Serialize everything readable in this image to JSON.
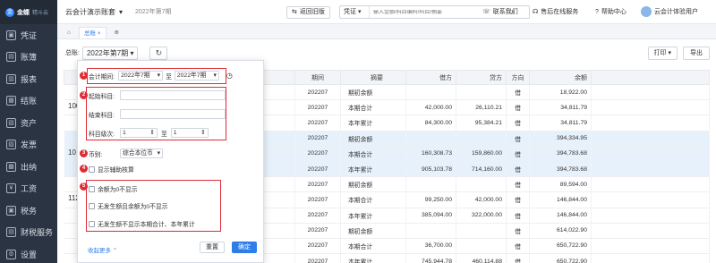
{
  "app": {
    "logo_mark": "金",
    "logo_text": "金蝶",
    "logo_sub": "精斗云"
  },
  "sidebar": {
    "items": [
      {
        "label": "凭证",
        "icon": "voucher-icon",
        "glyph": "▣"
      },
      {
        "label": "账簿",
        "icon": "ledger-icon",
        "glyph": "▤"
      },
      {
        "label": "报表",
        "icon": "report-icon",
        "glyph": "▥"
      },
      {
        "label": "结账",
        "icon": "closing-icon",
        "glyph": "▦"
      },
      {
        "label": "资产",
        "icon": "asset-icon",
        "glyph": "▧"
      },
      {
        "label": "发票",
        "icon": "invoice-icon",
        "glyph": "▨"
      },
      {
        "label": "出纳",
        "icon": "cashier-icon",
        "glyph": "▩"
      },
      {
        "label": "工资",
        "icon": "payroll-icon",
        "glyph": "¥"
      },
      {
        "label": "税务",
        "icon": "tax-icon",
        "glyph": "▣"
      },
      {
        "label": "财税服务",
        "icon": "service-icon",
        "glyph": "▤"
      },
      {
        "label": "设置",
        "icon": "settings-icon",
        "glyph": "⚙"
      }
    ]
  },
  "header": {
    "company": "云会计演示账套",
    "company_caret": "▾",
    "period": "2022年第7期",
    "back_btn": "返回旧版",
    "search_type": "凭证",
    "search_caret": "▾",
    "search_placeholder": "输入金额/科目编码/科目/摘要",
    "contact": "联系我们",
    "after_sales": "售后在线服务",
    "help": "帮助中心",
    "user": "云会计体验用户"
  },
  "tabs": [
    {
      "label": "⌂"
    },
    {
      "label": "总账 ×"
    },
    {
      "label": "⊕"
    }
  ],
  "toolbar": {
    "ledger_label": "总账:",
    "period_value": "2022年第7期",
    "period_caret": "▾",
    "refresh": "↻",
    "print": "打印 ▾",
    "export": "导出"
  },
  "table": {
    "headers": [
      "期间",
      "摘要",
      "借方",
      "贷方",
      "方向",
      "余额"
    ],
    "codes": [
      "100",
      "10",
      "112"
    ],
    "rows": [
      {
        "period": "202207",
        "abs": "期初余额",
        "debit": "",
        "credit": "",
        "dir": "借",
        "bal": "18,922.00",
        "hl": false
      },
      {
        "period": "202207",
        "abs": "本期合计",
        "debit": "42,000.00",
        "credit": "26,110.21",
        "dir": "借",
        "bal": "34,811.79",
        "hl": false
      },
      {
        "period": "202207",
        "abs": "本年累计",
        "debit": "84,300.00",
        "credit": "95,384.21",
        "dir": "借",
        "bal": "34,811.79",
        "hl": false
      },
      {
        "period": "202207",
        "abs": "期初余额",
        "debit": "",
        "credit": "",
        "dir": "借",
        "bal": "394,334.95",
        "hl": true
      },
      {
        "period": "202207",
        "abs": "本期合计",
        "debit": "160,308.73",
        "credit": "159,860.00",
        "dir": "借",
        "bal": "394,783.68",
        "hl": true
      },
      {
        "period": "202207",
        "abs": "本年累计",
        "debit": "905,103.78",
        "credit": "714,160.00",
        "dir": "借",
        "bal": "394,783.68",
        "hl": true
      },
      {
        "period": "202207",
        "abs": "期初余额",
        "debit": "",
        "credit": "",
        "dir": "借",
        "bal": "89,594.00",
        "hl": false
      },
      {
        "period": "202207",
        "abs": "本期合计",
        "debit": "99,250.00",
        "credit": "42,000.00",
        "dir": "借",
        "bal": "146,844.00",
        "hl": false
      },
      {
        "period": "202207",
        "abs": "本年累计",
        "debit": "385,094.00",
        "credit": "322,000.00",
        "dir": "借",
        "bal": "146,844.00",
        "hl": false
      },
      {
        "period": "202207",
        "abs": "期初余额",
        "debit": "",
        "credit": "",
        "dir": "借",
        "bal": "614,022.90",
        "hl": false
      },
      {
        "period": "202207",
        "abs": "本期合计",
        "debit": "36,700.00",
        "credit": "",
        "dir": "借",
        "bal": "650,722.90",
        "hl": false
      },
      {
        "period": "202207",
        "abs": "本年累计",
        "debit": "745,944.78",
        "credit": "460,114.88",
        "dir": "借",
        "bal": "650,722.90",
        "hl": false
      }
    ]
  },
  "popup": {
    "badges": [
      "1",
      "2",
      "3",
      "4",
      "5"
    ],
    "period_label": "会计期间:",
    "period_from": "2022年7期",
    "period_to": "2022年7期",
    "to_word": "至",
    "caret": "▾",
    "start_acct_label": "起始科目:",
    "end_acct_label": "结束科目:",
    "level_label": "科目级次:",
    "level_from": "1",
    "level_to": "1",
    "level_to_word": "至",
    "stepper_glyph": "⇕",
    "currency_label": "币别:",
    "currency_value": "综合本位币",
    "opt_aux": "显示辅助核算",
    "opt_zero_bal": "余额为0不显示",
    "opt_no_occur_zero": "无发生额且余额为0不显示",
    "opt_no_occur_hide": "无发生额不显示本期合计、本年累计",
    "more": "收起更多 ⌃",
    "reset": "重置",
    "ok": "确定",
    "clock": "◷"
  },
  "colors": {
    "accent": "#2e7de9",
    "annotation": "#e02b35",
    "sidebar": "#2b3442"
  }
}
